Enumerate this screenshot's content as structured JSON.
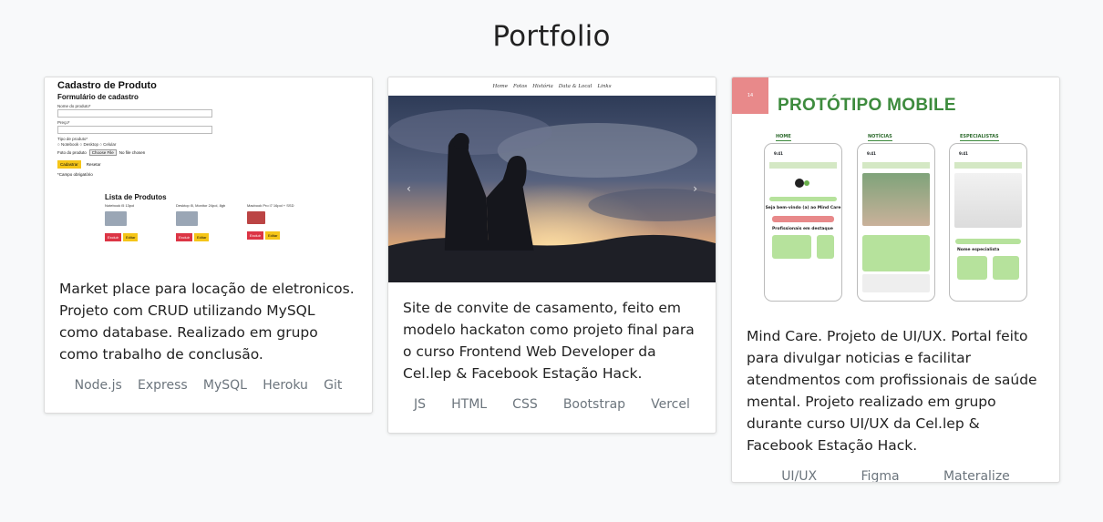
{
  "page": {
    "title": "Portfolio"
  },
  "cards": [
    {
      "mock": {
        "title": "Cadastro de Produto",
        "form_title": "Formulário de cadastro",
        "label_name": "Nome do produto*",
        "label_price": "Preço*",
        "label_type": "Tipo de produto*",
        "type_options": "○ Notebook ○ Desktop ○ Celular",
        "label_photo": "Foto do produto",
        "file_button": "Choose File",
        "file_status": "No file chosen",
        "submit": "Cadastrar",
        "reset": "Resetar",
        "note": "*Campo obrigatório",
        "list_title": "Lista de Produtos",
        "items": [
          {
            "name": "Notebook i5 13pol"
          },
          {
            "name": "Desktop i5, Monitor 24pol, 8gb"
          },
          {
            "name": "Macbook Pro i7 16pol + SSD"
          }
        ],
        "delete": "Excluir",
        "edit": "Editar"
      },
      "description": "Market place para locação de eletronicos. Projeto com CRUD utilizando MySQL como database. Realizado em grupo como trabalho de conclusão.",
      "tags": [
        "Node.js",
        "Express",
        "MySQL",
        "Heroku",
        "Git"
      ]
    },
    {
      "mock": {
        "nav": [
          "Home",
          "Fotos",
          "História",
          "Data & Local",
          "Links"
        ]
      },
      "description": "Site de convite de casamento, feito em modelo hackaton como projeto final para o curso Frontend Web Developer da Cel.lep & Facebook Estação Hack.",
      "tags": [
        "JS",
        "HTML",
        "CSS",
        "Bootstrap",
        "Vercel"
      ]
    },
    {
      "mock": {
        "badge": "14",
        "title": "PROTÓTIPO MOBILE",
        "sections": [
          "HOME",
          "NOTÍCIAS",
          "ESPECIALISTAS"
        ],
        "time": "9:41",
        "welcome": "Seja bem-vindo (a) ao Mind Care",
        "featured": "Profissionais em destaque",
        "specialists": "Nome especialista"
      },
      "description": "Mind Care. Projeto de UI/UX. Portal feito para divulgar noticias e facilitar atendmentos com profissionais de saúde mental. Projeto realizado em grupo durante curso UI/UX da Cel.lep & Facebook Estação Hack.",
      "tags": [
        "UI/UX",
        "Figma",
        "Materalize"
      ]
    }
  ],
  "colors": {
    "background": "#f8f9fa",
    "tag_text": "#6c757d",
    "mobile_green": "#3d8b3d",
    "badge_pink": "#e8898a"
  }
}
